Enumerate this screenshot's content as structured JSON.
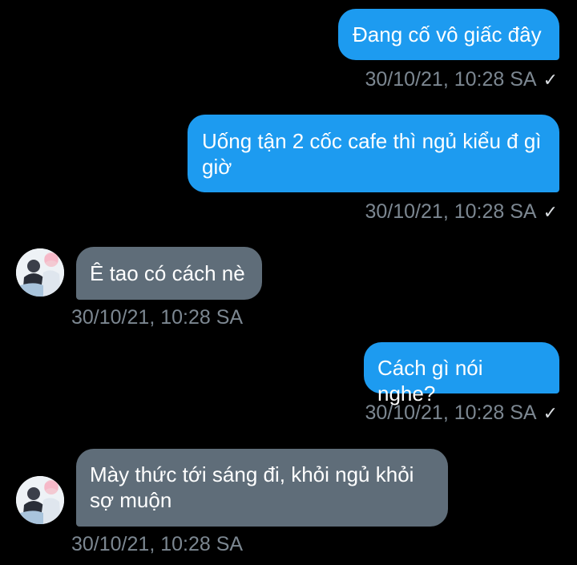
{
  "conversation": {
    "messages": [
      {
        "direction": "sent",
        "text": "Đang cố vô giấc đây",
        "time": "30/10/21, 10:28 SA",
        "read": "✓"
      },
      {
        "direction": "sent",
        "text": "Uống tận 2 cốc cafe thì ngủ kiểu đ gì giờ",
        "time": "30/10/21, 10:28 SA",
        "read": "✓"
      },
      {
        "direction": "received",
        "text": "Ê tao có cách nè",
        "time": "30/10/21, 10:28 SA"
      },
      {
        "direction": "sent",
        "text": "Cách gì nói nghe?",
        "time": "30/10/21, 10:28 SA",
        "read": "✓"
      },
      {
        "direction": "received",
        "text": "Mày thức tới sáng đi, khỏi ngủ khỏi sợ muộn",
        "time": "30/10/21, 10:28 SA"
      }
    ]
  },
  "colors": {
    "background": "#000000",
    "sent_bubble": "#1d9bf0",
    "received_bubble": "#5f6d79",
    "timestamp": "#7c8791"
  },
  "icons": {
    "read_receipt": "checkmark-icon",
    "contact_avatar": "avatar"
  }
}
